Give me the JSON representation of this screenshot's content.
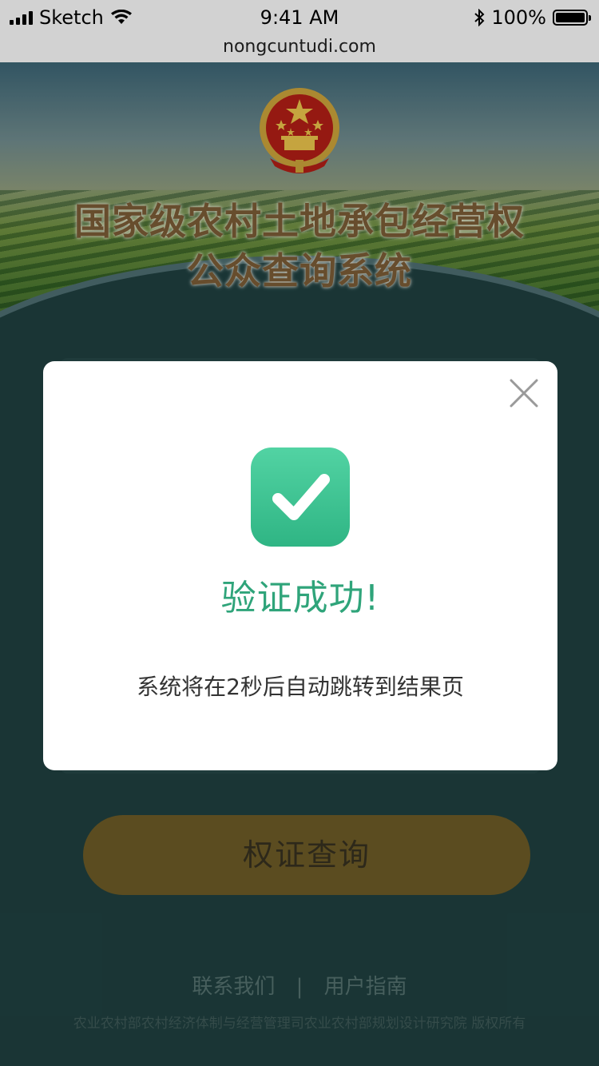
{
  "status_bar": {
    "carrier": "Sketch",
    "time": "9:41 AM",
    "battery": "100%"
  },
  "url": "nongcuntudi.com",
  "hero": {
    "title_line1": "国家级农村土地承包经营权",
    "title_line2": "公众查询系统"
  },
  "query_button": "权证查询",
  "footer": {
    "link_contact": "联系我们",
    "separator": "|",
    "link_guide": "用户指南",
    "copyright": "农业农村部农村经济体制与经营管理司农业农村部规划设计研究院   版权所有"
  },
  "modal": {
    "title": "验证成功!",
    "message": "系统将在2秒后自动跳转到结果页"
  },
  "colors": {
    "accent_green": "#2fa47a",
    "button_gold": "#6b5a26",
    "background": "#1f3f3f"
  }
}
